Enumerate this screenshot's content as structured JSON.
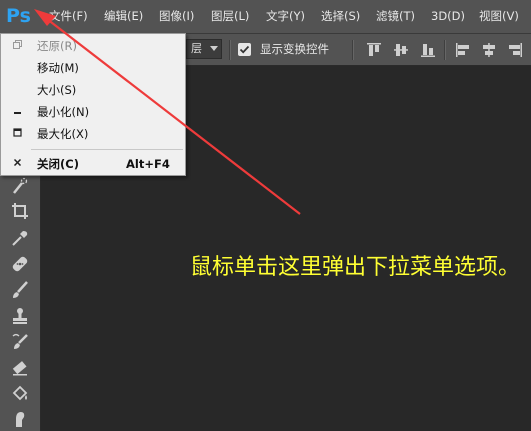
{
  "menubar": {
    "logo": "Ps",
    "items": [
      "文件(F)",
      "编辑(E)",
      "图像(I)",
      "图层(L)",
      "文字(Y)",
      "选择(S)",
      "滤镜(T)",
      "3D(D)",
      "视图(V)"
    ]
  },
  "options": {
    "layer_select_value": "层",
    "show_transform_label": "显示变换控件",
    "show_transform_checked": true
  },
  "system_menu": {
    "items": [
      {
        "label": "还原(R)",
        "icon": "restore-icon",
        "disabled": true
      },
      {
        "label": "移动(M)",
        "icon": "",
        "disabled": false
      },
      {
        "label": "大小(S)",
        "icon": "",
        "disabled": false
      },
      {
        "label": "最小化(N)",
        "icon": "minimize-icon",
        "disabled": false
      },
      {
        "label": "最大化(X)",
        "icon": "maximize-icon",
        "disabled": false
      }
    ],
    "close": {
      "label": "关闭(C)",
      "shortcut": "Alt+F4",
      "icon": "close-icon"
    }
  },
  "annotation": {
    "text": "鼠标单击这里弹出下拉菜单选项。",
    "color": "#ffff33"
  },
  "colors": {
    "logo": "#2ea3f2",
    "arrow": "#ee3b3b",
    "chrome": "#535353",
    "workspace": "#282828"
  },
  "tools": [
    "quick-selection-icon",
    "crop-icon",
    "eyedropper-icon",
    "healing-brush-icon",
    "brush-icon",
    "clone-stamp-icon",
    "history-brush-icon",
    "eraser-icon",
    "paint-bucket-icon",
    "smudge-icon"
  ]
}
